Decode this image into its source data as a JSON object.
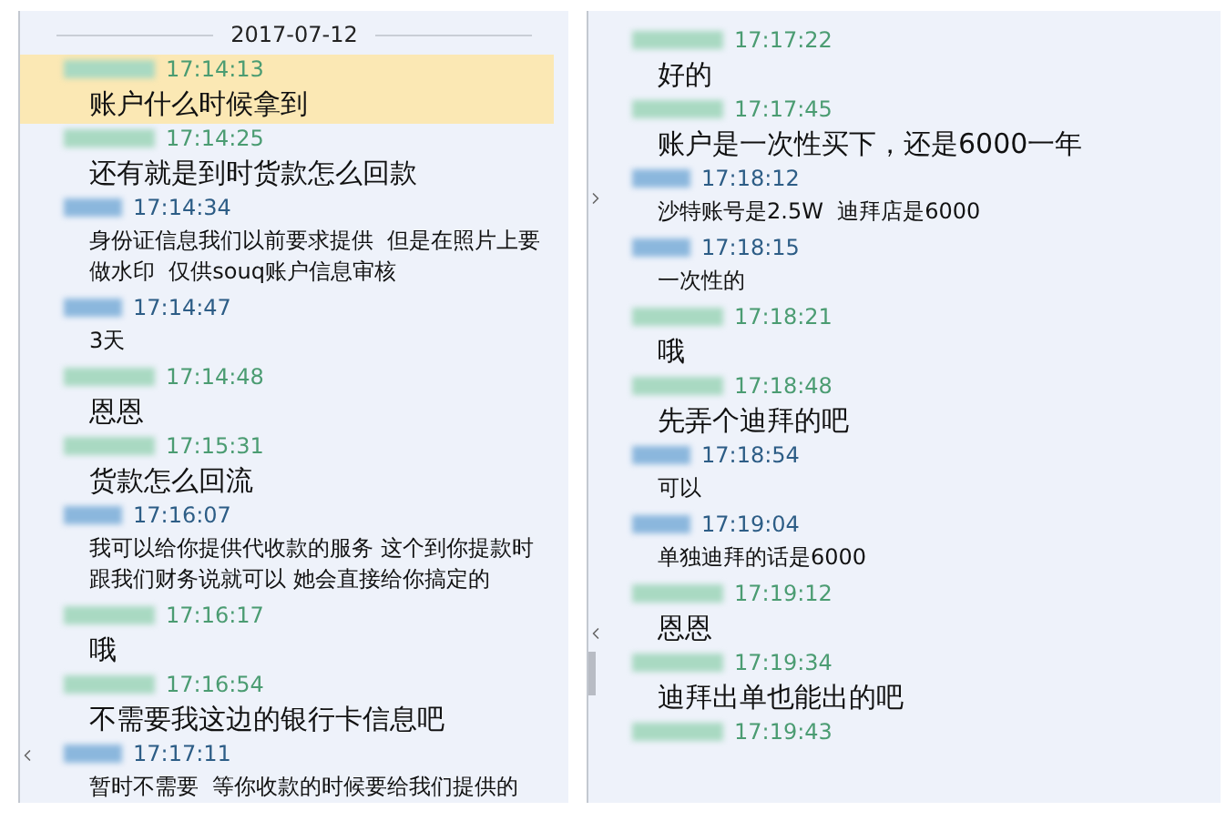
{
  "left_panel": {
    "date": "2017-07-12",
    "messages": [
      {
        "kind": "customer",
        "time": "17:14:13",
        "text": "账户什么时候拿到",
        "highlighted": true
      },
      {
        "kind": "customer",
        "time": "17:14:25",
        "text": "还有就是到时货款怎么回款",
        "highlighted": false
      },
      {
        "kind": "seller",
        "time": "17:14:34",
        "text": "身份证信息我们以前要求提供  但是在照片上要做水印  仅供souq账户信息审核",
        "highlighted": false
      },
      {
        "kind": "seller",
        "time": "17:14:47",
        "text": "3天",
        "highlighted": false
      },
      {
        "kind": "customer",
        "time": "17:14:48",
        "text": "恩恩",
        "highlighted": false
      },
      {
        "kind": "customer",
        "time": "17:15:31",
        "text": "货款怎么回流",
        "highlighted": false
      },
      {
        "kind": "seller",
        "time": "17:16:07",
        "text": "我可以给你提供代收款的服务 这个到你提款时跟我们财务说就可以 她会直接给你搞定的",
        "highlighted": false
      },
      {
        "kind": "customer",
        "time": "17:16:17",
        "text": "哦",
        "highlighted": false
      },
      {
        "kind": "customer",
        "time": "17:16:54",
        "text": "不需要我这边的银行卡信息吧",
        "highlighted": false
      },
      {
        "kind": "seller",
        "time": "17:17:11",
        "text": "暂时不需要  等你收款的时候要给我们提供的",
        "highlighted": false
      }
    ]
  },
  "right_panel": {
    "messages": [
      {
        "kind": "customer",
        "time": "17:17:22",
        "text": "好的",
        "highlighted": false
      },
      {
        "kind": "customer",
        "time": "17:17:45",
        "text": "账户是一次性买下，还是6000一年",
        "highlighted": false
      },
      {
        "kind": "seller",
        "time": "17:18:12",
        "text": "沙特账号是2.5W  迪拜店是6000",
        "highlighted": false
      },
      {
        "kind": "seller",
        "time": "17:18:15",
        "text": "一次性的",
        "highlighted": false
      },
      {
        "kind": "customer",
        "time": "17:18:21",
        "text": "哦",
        "highlighted": false
      },
      {
        "kind": "customer",
        "time": "17:18:48",
        "text": "先弄个迪拜的吧",
        "highlighted": false
      },
      {
        "kind": "seller",
        "time": "17:18:54",
        "text": "可以",
        "highlighted": false
      },
      {
        "kind": "seller",
        "time": "17:19:04",
        "text": "单独迪拜的话是6000",
        "highlighted": false
      },
      {
        "kind": "customer",
        "time": "17:19:12",
        "text": "恩恩",
        "highlighted": false
      },
      {
        "kind": "customer",
        "time": "17:19:34",
        "text": "迪拜出单也能出的吧",
        "highlighted": false
      },
      {
        "kind": "customer",
        "time": "17:19:43",
        "highlighted": false
      }
    ]
  }
}
